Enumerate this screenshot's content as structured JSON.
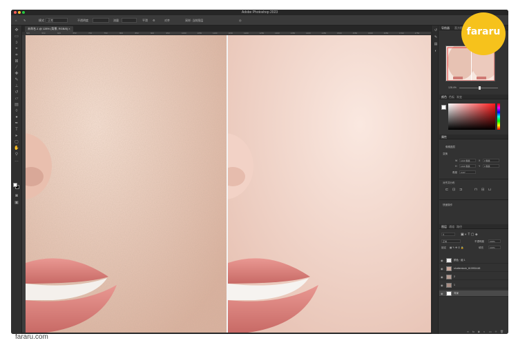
{
  "app": {
    "title": "Adobe Photoshop 2023",
    "document_tab": "未命名-1 @ 128% (背景, RGB/8)",
    "zoom_percent": "128.4%"
  },
  "options_bar": {
    "items": [
      "模式",
      "正常",
      "不透明度",
      "流量",
      "平滑",
      "对齐",
      "采样: 当前图层"
    ]
  },
  "ruler": {
    "ticks": [
      "500",
      "550",
      "600",
      "650",
      "700",
      "750",
      "800",
      "850",
      "900",
      "950",
      "1000",
      "1050",
      "1100",
      "1150",
      "1200",
      "1250",
      "1300",
      "1350",
      "1400",
      "1450",
      "1500",
      "1550",
      "1600",
      "1650",
      "1700",
      "1750"
    ]
  },
  "panels": {
    "navigator": {
      "tabs": [
        "导航器",
        "直方图"
      ]
    },
    "color": {
      "tabs": [
        "颜色",
        "色板",
        "渐变"
      ]
    },
    "properties": {
      "title": "属性",
      "section": "像素图层",
      "transform_label": "变换",
      "fields": [
        {
          "label": "W",
          "value": "1440 像素"
        },
        {
          "label": "X",
          "value": "0 像素"
        },
        {
          "label": "H",
          "value": "1440 像素"
        },
        {
          "label": "Y",
          "value": "0 像素"
        },
        {
          "label": "角度",
          "value": "0.00°"
        }
      ],
      "align_label": "对齐并分布",
      "quick_actions": "快速操作"
    },
    "layers": {
      "tabs": [
        "图层",
        "通道",
        "路径"
      ],
      "blend_mode": "正常",
      "opacity_label": "不透明度",
      "opacity": "100%",
      "fill_label": "填充",
      "fill": "100%",
      "lock_label": "锁定",
      "items": [
        {
          "name": "颜色 · 组 1",
          "visible": true,
          "thumb": "#e9e9e9",
          "selected": false
        },
        {
          "name": "shutterstock_610951448",
          "visible": true,
          "thumb": "#c9a79a",
          "selected": false
        },
        {
          "name": "2",
          "visible": true,
          "thumb": "#b49a90",
          "selected": false
        },
        {
          "name": "1",
          "visible": true,
          "thumb": "#a88e84",
          "selected": false
        },
        {
          "name": "背景",
          "visible": true,
          "thumb": "#ffffff",
          "selected": true
        }
      ]
    }
  },
  "colors": {
    "skin_left": "#e5c3b2",
    "skin_right": "#f0cfc4",
    "lips": "#d9827c"
  },
  "watermark": {
    "text": "fararu"
  },
  "source_caption": "fararu.com"
}
